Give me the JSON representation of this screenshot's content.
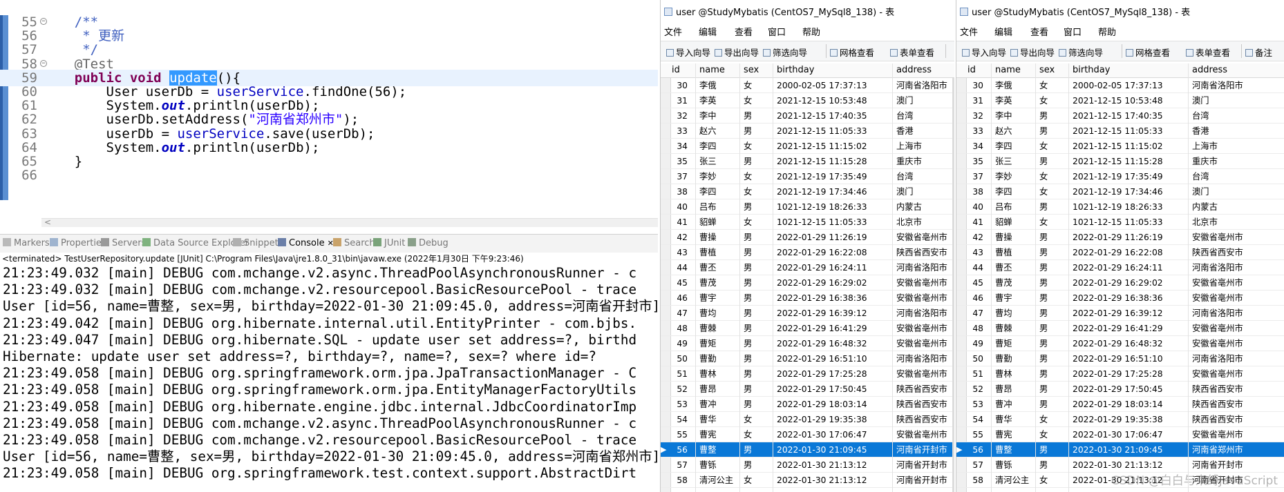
{
  "editor": {
    "lines": [
      {
        "num": "55",
        "fold": true,
        "parts": [
          {
            "c": "cm",
            "t": "    /**"
          }
        ]
      },
      {
        "num": "56",
        "parts": [
          {
            "c": "cm",
            "t": "     * 更新"
          }
        ]
      },
      {
        "num": "57",
        "parts": [
          {
            "c": "cm",
            "t": "     */"
          }
        ]
      },
      {
        "num": "58",
        "fold": true,
        "parts": [
          {
            "c": "an",
            "t": "    @Test"
          }
        ]
      },
      {
        "num": "59",
        "current": true,
        "parts": [
          {
            "c": "",
            "t": "    "
          },
          {
            "c": "kw",
            "t": "public"
          },
          {
            "c": "",
            "t": " "
          },
          {
            "c": "kw",
            "t": "void"
          },
          {
            "c": "",
            "t": " "
          },
          {
            "c": "sel",
            "t": "update"
          },
          {
            "c": "",
            "t": "(){"
          }
        ]
      },
      {
        "num": "60",
        "parts": [
          {
            "c": "",
            "t": "        User userDb = "
          },
          {
            "c": "fld",
            "t": "userService"
          },
          {
            "c": "",
            "t": ".findOne(56);"
          }
        ]
      },
      {
        "num": "61",
        "parts": [
          {
            "c": "",
            "t": "        System."
          },
          {
            "c": "it",
            "t": "out"
          },
          {
            "c": "",
            "t": ".println(userDb);"
          }
        ]
      },
      {
        "num": "62",
        "parts": [
          {
            "c": "",
            "t": "        userDb.setAddress("
          },
          {
            "c": "st",
            "t": "\"河南省郑州市\""
          },
          {
            "c": "",
            "t": ");"
          }
        ]
      },
      {
        "num": "63",
        "parts": [
          {
            "c": "",
            "t": "        userDb = "
          },
          {
            "c": "fld",
            "t": "userService"
          },
          {
            "c": "",
            "t": ".save(userDb);"
          }
        ]
      },
      {
        "num": "64",
        "parts": [
          {
            "c": "",
            "t": "        System."
          },
          {
            "c": "it",
            "t": "out"
          },
          {
            "c": "",
            "t": ".println(userDb);"
          }
        ]
      },
      {
        "num": "65",
        "parts": [
          {
            "c": "",
            "t": "    }"
          }
        ]
      },
      {
        "num": "66",
        "parts": [
          {
            "c": "",
            "t": ""
          }
        ]
      }
    ],
    "scroll_arrow": "<"
  },
  "panel_tabs": [
    {
      "label": "Markers",
      "icon": "markers-icon"
    },
    {
      "label": "Properties",
      "icon": "properties-icon"
    },
    {
      "label": "Servers",
      "icon": "servers-icon"
    },
    {
      "label": "Data Source Explorer",
      "icon": "data-source-icon"
    },
    {
      "label": "Snippets",
      "icon": "snippets-icon"
    },
    {
      "label": "Console",
      "icon": "console-icon",
      "active": true,
      "close": "✕"
    },
    {
      "label": "Search",
      "icon": "search-icon"
    },
    {
      "label": "JUnit",
      "icon": "junit-icon"
    },
    {
      "label": "Debug",
      "icon": "debug-icon"
    }
  ],
  "terminated_text": "<terminated> TestUserRepository.update [JUnit] C:\\Program Files\\Java\\jre1.8.0_31\\bin\\javaw.exe (2022年1月30日 下午9:23:46)",
  "console_lines": [
    "21:23:49.032 [main] DEBUG com.mchange.v2.async.ThreadPoolAsynchronousRunner - c",
    "21:23:49.032 [main] DEBUG com.mchange.v2.resourcepool.BasicResourcePool - trace",
    "User [id=56, name=曹整, sex=男, birthday=2022-01-30 21:09:45.0, address=河南省开封市]",
    "21:23:49.042 [main] DEBUG org.hibernate.internal.util.EntityPrinter - com.bjbs.",
    "21:23:49.047 [main] DEBUG org.hibernate.SQL - update user set address=?, birthd",
    "Hibernate: update user set address=?, birthday=?, name=?, sex=? where id=?",
    "21:23:49.058 [main] DEBUG org.springframework.orm.jpa.JpaTransactionManager - C",
    "21:23:49.058 [main] DEBUG org.springframework.orm.jpa.EntityManagerFactoryUtils",
    "21:23:49.058 [main] DEBUG org.hibernate.engine.jdbc.internal.JdbcCoordinatorImp",
    "21:23:49.058 [main] DEBUG com.mchange.v2.async.ThreadPoolAsynchronousRunner - c",
    "21:23:49.058 [main] DEBUG com.mchange.v2.resourcepool.BasicResourcePool - trace",
    "User [id=56, name=曹整, sex=男, birthday=2022-01-30 21:09:45.0, address=河南省郑州市]",
    "21:23:49.058 [main] DEBUG org.springframework.test.context.support.AbstractDirt"
  ],
  "navicat_left": {
    "title": "user @StudyMybatis (CentOS7_MySql8_138) - 表",
    "menu": [
      "文件",
      "编辑",
      "查看",
      "窗口",
      "帮助"
    ],
    "toolbar": [
      "导入向导",
      "导出向导",
      "筛选向导",
      "网格查看",
      "表单查看"
    ],
    "columns": [
      "id",
      "name",
      "sex",
      "birthday",
      "address"
    ],
    "rows": [
      [
        "30",
        "李俄",
        "女",
        "2000-02-05 17:37:13",
        "河南省洛阳市"
      ],
      [
        "31",
        "李英",
        "女",
        "2021-12-15 10:53:48",
        "澳门"
      ],
      [
        "32",
        "李中",
        "男",
        "2021-12-15 17:40:35",
        "台湾"
      ],
      [
        "33",
        "赵六",
        "男",
        "2021-12-15 11:05:33",
        "香港"
      ],
      [
        "34",
        "李四",
        "女",
        "2021-12-15 11:15:02",
        "上海市"
      ],
      [
        "35",
        "张三",
        "男",
        "2021-12-15 11:15:28",
        "重庆市"
      ],
      [
        "37",
        "李妙",
        "女",
        "2021-12-19 17:35:49",
        "台湾"
      ],
      [
        "38",
        "李四",
        "女",
        "2021-12-19 17:34:46",
        "澳门"
      ],
      [
        "40",
        "吕布",
        "男",
        "1021-12-19 18:26:33",
        "内蒙古"
      ],
      [
        "41",
        "貂蝉",
        "女",
        "1021-12-15 11:05:33",
        "北京市"
      ],
      [
        "42",
        "曹操",
        "男",
        "2022-01-29 11:26:19",
        "安徽省亳州市"
      ],
      [
        "43",
        "曹植",
        "男",
        "2022-01-29 16:22:08",
        "陕西省西安市"
      ],
      [
        "44",
        "曹丕",
        "男",
        "2022-01-29 16:24:11",
        "河南省洛阳市"
      ],
      [
        "45",
        "曹茂",
        "男",
        "2022-01-29 16:29:02",
        "安徽省亳州市"
      ],
      [
        "46",
        "曹宇",
        "男",
        "2022-01-29 16:38:36",
        "安徽省亳州市"
      ],
      [
        "47",
        "曹均",
        "男",
        "2022-01-29 16:39:12",
        "河南省洛阳市"
      ],
      [
        "48",
        "曹棘",
        "男",
        "2022-01-29 16:41:29",
        "安徽省亳州市"
      ],
      [
        "49",
        "曹矩",
        "男",
        "2022-01-29 16:48:32",
        "安徽省亳州市"
      ],
      [
        "50",
        "曹勤",
        "男",
        "2022-01-29 16:51:10",
        "河南省洛阳市"
      ],
      [
        "51",
        "曹林",
        "男",
        "2022-01-29 17:25:28",
        "安徽省亳州市"
      ],
      [
        "52",
        "曹昂",
        "男",
        "2022-01-29 17:50:45",
        "陕西省西安市"
      ],
      [
        "53",
        "曹冲",
        "男",
        "2022-01-29 18:03:14",
        "陕西省西安市"
      ],
      [
        "54",
        "曹华",
        "女",
        "2022-01-29 19:35:38",
        "陕西省西安市"
      ],
      [
        "55",
        "曹宪",
        "女",
        "2022-01-30 17:06:47",
        "安徽省亳州市"
      ],
      [
        "56",
        "曹整",
        "男",
        "2022-01-30 21:09:45",
        "河南省开封市"
      ],
      [
        "57",
        "曹铄",
        "男",
        "2022-01-30 21:13:12",
        "河南省开封市"
      ],
      [
        "58",
        "清河公主",
        "女",
        "2022-01-30 21:13:12",
        "河南省开封市"
      ]
    ],
    "selected_index": 24
  },
  "navicat_right": {
    "title": "user @StudyMybatis (CentOS7_MySql8_138) - 表",
    "menu": [
      "文件",
      "编辑",
      "查看",
      "窗口",
      "帮助"
    ],
    "toolbar": [
      "导入向导",
      "导出向导",
      "筛选向导",
      "网格查看",
      "表单查看",
      "备注"
    ],
    "columns": [
      "id",
      "name",
      "sex",
      "birthday",
      "address"
    ],
    "rows": [
      [
        "30",
        "李俄",
        "女",
        "2000-02-05 17:37:13",
        "河南省洛阳市"
      ],
      [
        "31",
        "李英",
        "女",
        "2021-12-15 10:53:48",
        "澳门"
      ],
      [
        "32",
        "李中",
        "男",
        "2021-12-15 17:40:35",
        "台湾"
      ],
      [
        "33",
        "赵六",
        "男",
        "2021-12-15 11:05:33",
        "香港"
      ],
      [
        "34",
        "李四",
        "女",
        "2021-12-15 11:15:02",
        "上海市"
      ],
      [
        "35",
        "张三",
        "男",
        "2021-12-15 11:15:28",
        "重庆市"
      ],
      [
        "37",
        "李妙",
        "女",
        "2021-12-19 17:35:49",
        "台湾"
      ],
      [
        "38",
        "李四",
        "女",
        "2021-12-19 17:34:46",
        "澳门"
      ],
      [
        "40",
        "吕布",
        "男",
        "1021-12-19 18:26:33",
        "内蒙古"
      ],
      [
        "41",
        "貂蝉",
        "女",
        "1021-12-15 11:05:33",
        "北京市"
      ],
      [
        "42",
        "曹操",
        "男",
        "2022-01-29 11:26:19",
        "安徽省亳州市"
      ],
      [
        "43",
        "曹植",
        "男",
        "2022-01-29 16:22:08",
        "陕西省西安市"
      ],
      [
        "44",
        "曹丕",
        "男",
        "2022-01-29 16:24:11",
        "河南省洛阳市"
      ],
      [
        "45",
        "曹茂",
        "男",
        "2022-01-29 16:29:02",
        "安徽省亳州市"
      ],
      [
        "46",
        "曹宇",
        "男",
        "2022-01-29 16:38:36",
        "安徽省亳州市"
      ],
      [
        "47",
        "曹均",
        "男",
        "2022-01-29 16:39:12",
        "河南省洛阳市"
      ],
      [
        "48",
        "曹棘",
        "男",
        "2022-01-29 16:41:29",
        "安徽省亳州市"
      ],
      [
        "49",
        "曹矩",
        "男",
        "2022-01-29 16:48:32",
        "安徽省亳州市"
      ],
      [
        "50",
        "曹勤",
        "男",
        "2022-01-29 16:51:10",
        "河南省洛阳市"
      ],
      [
        "51",
        "曹林",
        "男",
        "2022-01-29 17:25:28",
        "安徽省亳州市"
      ],
      [
        "52",
        "曹昂",
        "男",
        "2022-01-29 17:50:45",
        "陕西省西安市"
      ],
      [
        "53",
        "曹冲",
        "男",
        "2022-01-29 18:03:14",
        "陕西省西安市"
      ],
      [
        "54",
        "曹华",
        "女",
        "2022-01-29 19:35:38",
        "陕西省西安市"
      ],
      [
        "55",
        "曹宪",
        "女",
        "2022-01-30 17:06:47",
        "安徽省亳州市"
      ],
      [
        "56",
        "曹整",
        "男",
        "2022-01-30 21:09:45",
        "河南省郑州市"
      ],
      [
        "57",
        "曹铄",
        "男",
        "2022-01-30 21:13:12",
        "河南省开封市"
      ],
      [
        "58",
        "清河公主",
        "女",
        "2022-01-30 21:13:12",
        "河南省开封市"
      ]
    ],
    "selected_index": 24
  },
  "watermark": "CSDN @白白与束缚JavaScript",
  "colors": {
    "selection": "#0a78d7",
    "keyword": "#7f0055",
    "field": "#0000c0",
    "string": "#2a00ff",
    "comment": "#3f5fbf"
  }
}
